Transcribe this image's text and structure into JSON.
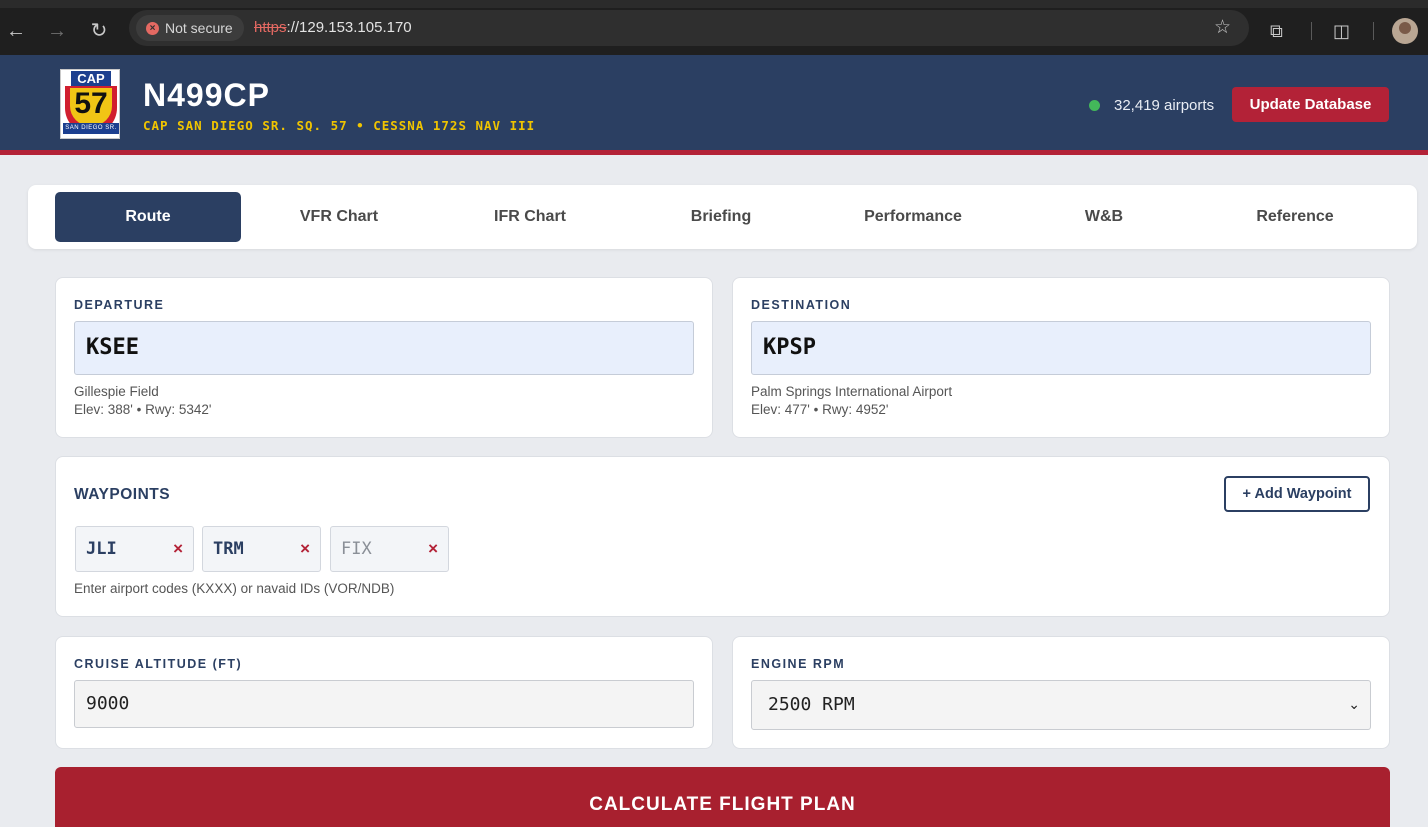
{
  "browser": {
    "security_label": "Not secure",
    "url_scheme": "https",
    "url_rest": "://129.153.105.170"
  },
  "header": {
    "logo": {
      "top_text": "CAP",
      "number": "57",
      "ribbon": "SAN DIEGO SR. SQ."
    },
    "tail_number": "N499CP",
    "subtitle": "CAP SAN DIEGO SR. SQ. 57 • CESSNA 172S NAV III",
    "airport_count": "32,419 airports",
    "update_button": "Update Database",
    "status_color": "#43b85a"
  },
  "tabs": [
    {
      "label": "Route",
      "active": true
    },
    {
      "label": "VFR Chart"
    },
    {
      "label": "IFR Chart"
    },
    {
      "label": "Briefing"
    },
    {
      "label": "Performance"
    },
    {
      "label": "W&B"
    },
    {
      "label": "Reference"
    }
  ],
  "departure": {
    "label": "DEPARTURE",
    "code": "KSEE",
    "name": "Gillespie Field",
    "details": "Elev: 388' • Rwy: 5342'"
  },
  "destination": {
    "label": "DESTINATION",
    "code": "KPSP",
    "name": "Palm Springs International Airport",
    "details": "Elev: 477' • Rwy: 4952'"
  },
  "waypoints": {
    "title": "WAYPOINTS",
    "add_button": "+ Add Waypoint",
    "items": [
      {
        "value": "JLI",
        "remove": "×"
      },
      {
        "value": "TRM",
        "remove": "×"
      },
      {
        "placeholder": "FIX",
        "remove": "×"
      }
    ],
    "help": "Enter airport codes (KXXX) or navaid IDs (VOR/NDB)"
  },
  "cruise": {
    "label": "CRUISE ALTITUDE (FT)",
    "value": "9000"
  },
  "rpm": {
    "label": "ENGINE RPM",
    "selected": "2500 RPM",
    "chevron": "⌄"
  },
  "calculate_button": "CALCULATE FLIGHT PLAN",
  "colors": {
    "navy": "#2b3f62",
    "red": "#b32237",
    "gold": "#f0c400"
  }
}
